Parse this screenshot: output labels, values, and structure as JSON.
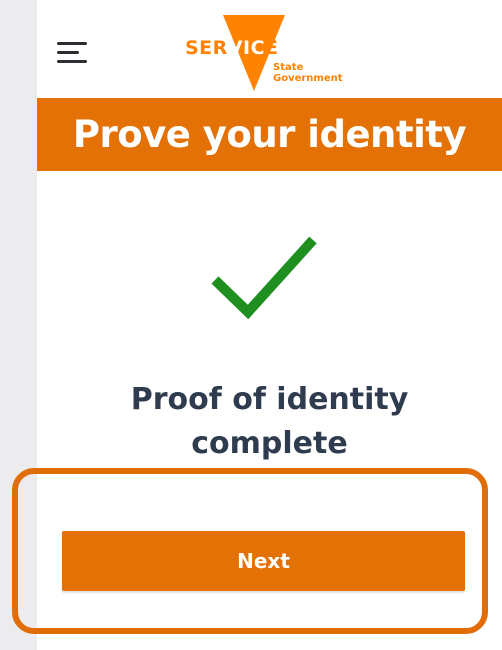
{
  "header": {
    "menu_icon": "hamburger-menu-icon",
    "logo": {
      "word_part1": "SER",
      "word_part2": "VIC",
      "word_part3": "E",
      "subtitle_line1": "State",
      "subtitle_line2": "Government"
    }
  },
  "banner": {
    "title": "Prove your identity"
  },
  "status": {
    "icon": "checkmark-icon",
    "message": "Proof of identity complete"
  },
  "actions": {
    "next_label": "Next"
  },
  "colors": {
    "brand_orange": "#e37106",
    "logo_orange": "#ff8200",
    "check_green": "#1f8f1f",
    "text_dark": "#2f3b4f",
    "highlight_outline": "#e06d07"
  }
}
